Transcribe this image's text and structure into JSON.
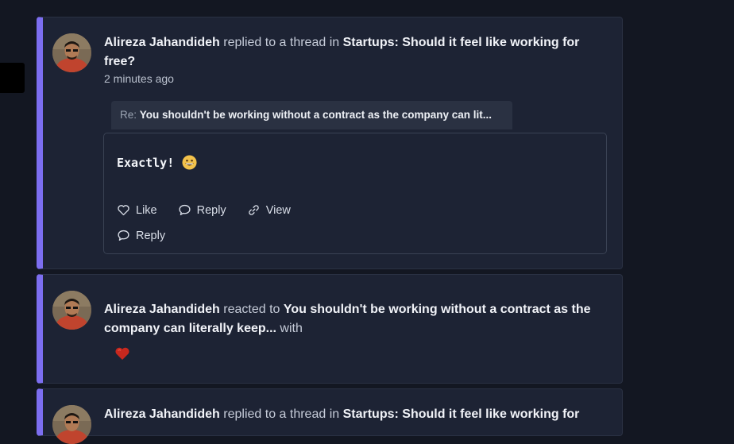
{
  "colors": {
    "background": "#131722",
    "card": "#1d2334",
    "accent_bar": "#7c6ef0",
    "heart": "#c8281e"
  },
  "feed": [
    {
      "author": "Alireza Jahandideh",
      "action": " replied to a thread in ",
      "target": "Startups: Should it feel like working for free?",
      "time": "2 minutes ago",
      "quote_prefix": "Re: ",
      "quote_text": "You shouldn't be working without a contract as the company can lit...",
      "reply_text": "Exactly!",
      "reply_emoji": "grinning-face-icon",
      "actions": {
        "like": "Like",
        "reply": "Reply",
        "view": "View",
        "reply_bottom": "Reply"
      }
    },
    {
      "author": "Alireza Jahandideh",
      "action": " reacted to ",
      "target": "You shouldn't be working without a contract as the company can literally keep...",
      "suffix": " with",
      "reaction_icon": "heart-icon"
    },
    {
      "author": "Alireza Jahandideh",
      "action": " replied to a thread in ",
      "target": "Startups: Should it feel like working for"
    }
  ]
}
